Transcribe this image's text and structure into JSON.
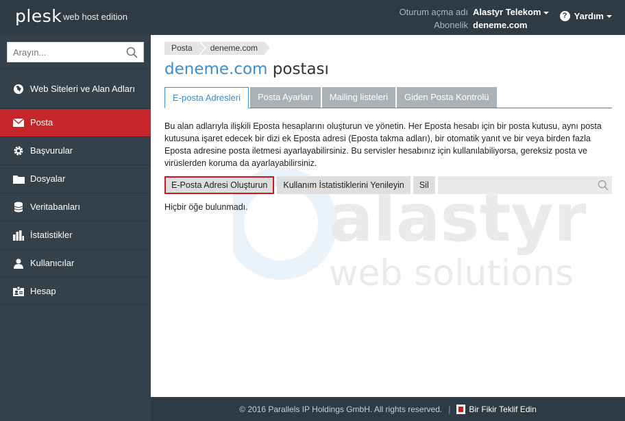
{
  "header": {
    "logo": "plesk",
    "edition": "web host edition",
    "login_label": "Oturum açma adı",
    "login_value": "Alastyr Telekom",
    "subscription_label": "Abonelik",
    "subscription_value": "deneme.com",
    "help_label": "Yardım"
  },
  "sidebar": {
    "search_placeholder": "Arayın...",
    "items": [
      {
        "label": "Web Siteleri ve Alan Adları",
        "icon": "globe-icon"
      },
      {
        "label": "Posta",
        "icon": "envelope-icon",
        "active": true
      },
      {
        "label": "Başvurular",
        "icon": "gear-icon"
      },
      {
        "label": "Dosyalar",
        "icon": "folder-icon"
      },
      {
        "label": "Veritabanları",
        "icon": "database-icon"
      },
      {
        "label": "İstatistikler",
        "icon": "bar-chart-icon"
      },
      {
        "label": "Kullanıcılar",
        "icon": "user-icon"
      },
      {
        "label": "Hesap",
        "icon": "id-card-icon"
      }
    ]
  },
  "breadcrumb": [
    "Posta",
    "deneme.com"
  ],
  "page_title": {
    "domain": "deneme.com",
    "suffix": "postası"
  },
  "tabs": [
    {
      "label": "E-posta Adresleri",
      "active": true
    },
    {
      "label": "Posta Ayarları"
    },
    {
      "label": "Mailing listeleri"
    },
    {
      "label": "Giden Posta Kontrolü"
    }
  ],
  "description": "Bu alan adlarıyla ilişkili Eposta hesaplarını oluşturun ve yönetin. Her Eposta hesabı için bir posta kutusu, aynı posta kutusuna işaret edecek bir dizi ek Eposta adresi (Eposta takma adları), bir otomatik yanıt ve bir veya birden fazla Eposta adresine posta iletmesi ayarlayabilirsiniz. Bu servisler hesabınız için kullanılabiliyorsa, gereksiz posta ve virüslerden koruma da ayarlayabilirsiniz.",
  "toolbar": {
    "create_label": "E-Posta Adresi Oluşturun",
    "refresh_label": "Kullanım İstatistiklerini Yenileyin",
    "delete_label": "Sil"
  },
  "empty_message": "Hiçbir öğe bulunmadı.",
  "footer": {
    "copyright": "© 2016 Parallels IP Holdings GmbH. All rights reserved.",
    "separator": "|",
    "idea_label": "Bir Fikir Teklif Edin"
  },
  "watermark": {
    "line1": "alastyr",
    "line2": "web solutions"
  },
  "colors": {
    "header_bg": "#2e3b45",
    "sidebar_bg": "#34414b",
    "active_nav": "#c5262b",
    "accent_blue": "#3b8ed0",
    "highlight_border": "#d0181f"
  }
}
